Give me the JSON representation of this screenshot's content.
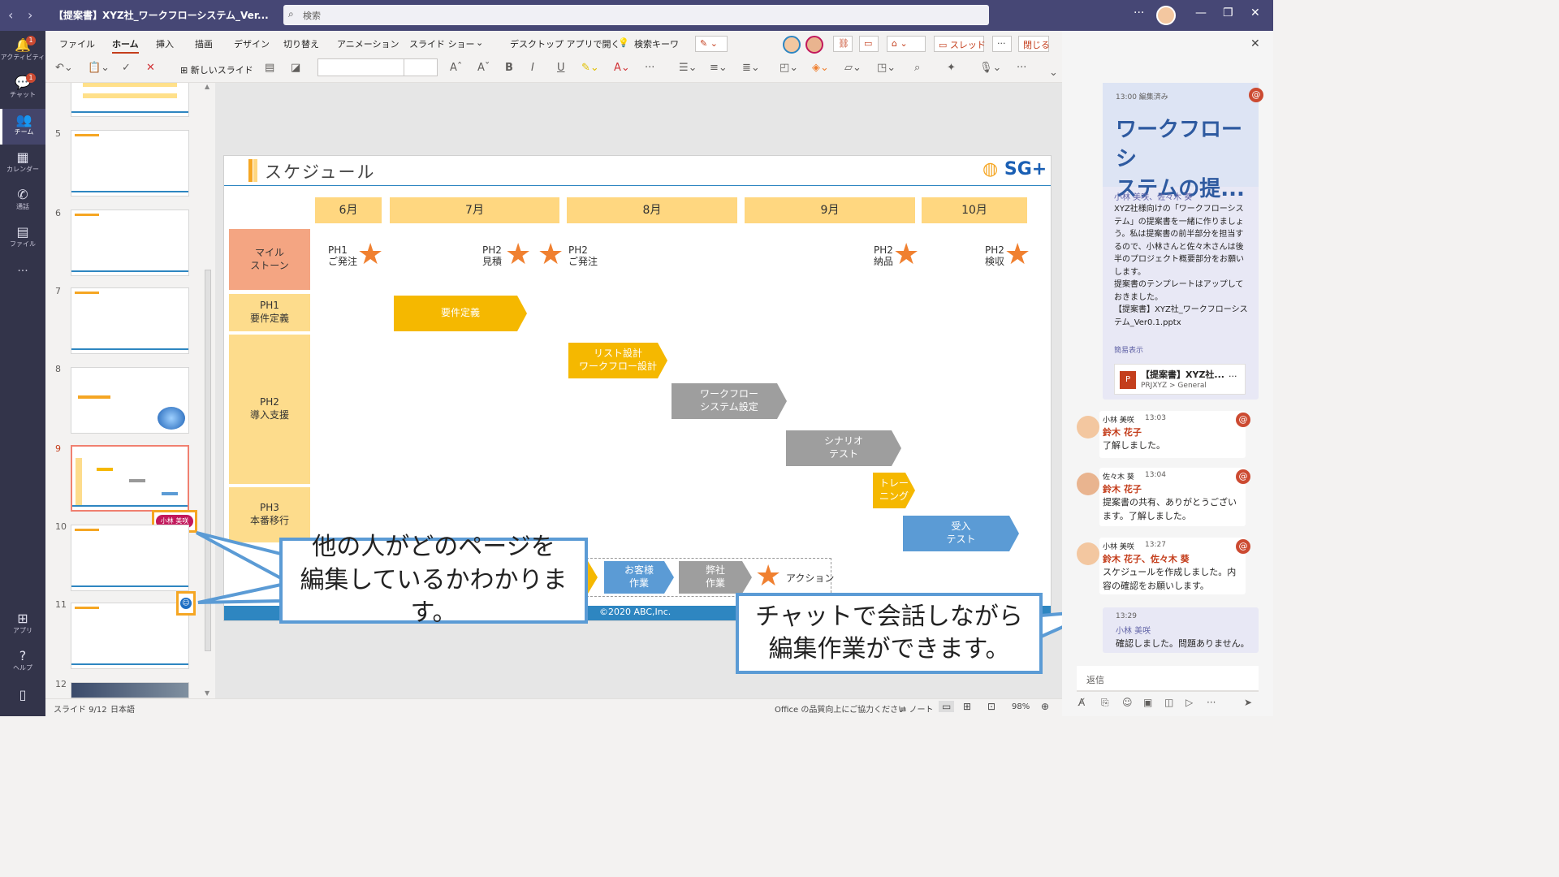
{
  "titlebar": {
    "doc_title": "【提案書】XYZ社_ワークフローシステム_Ver...",
    "search_placeholder": "検索"
  },
  "rail": {
    "items": [
      {
        "label": "アクティビティ",
        "badge": "1"
      },
      {
        "label": "チャット",
        "badge": "1"
      },
      {
        "label": "チーム"
      },
      {
        "label": "カレンダー"
      },
      {
        "label": "通話"
      },
      {
        "label": "ファイル"
      },
      {
        "label": "..."
      },
      {
        "label": "アプリ"
      },
      {
        "label": "ヘルプ"
      }
    ]
  },
  "ribbon": {
    "tabs": [
      "ファイル",
      "ホーム",
      "挿入",
      "描画",
      "デザイン",
      "切り替え",
      "アニメーション",
      "スライド ショー"
    ],
    "open_desktop": "デスクトップ アプリで開く",
    "search_keyword": "検索キーワ",
    "new_slide": "新しいスライド",
    "thread_btn": "スレッド",
    "close_btn": "閉じる"
  },
  "thumbs": {
    "numbers": [
      "5",
      "6",
      "7",
      "8",
      "9",
      "10",
      "11",
      "12"
    ],
    "editor_tag": "小林 美咲"
  },
  "slide": {
    "title": "スケジュール",
    "logo": "SG+",
    "months": [
      "6月",
      "7月",
      "8月",
      "9月",
      "10月"
    ],
    "rows": [
      "マイル\nストーン",
      "PH1\n要件定義",
      "PH2\n導入支援",
      "PH3\n本番移行"
    ],
    "milestones": [
      {
        "text": "PH1\nご発注"
      },
      {
        "text": "PH2\n見積"
      },
      {
        "text": "PH2\nご発注"
      },
      {
        "text": "PH2\n納品"
      },
      {
        "text": "PH2\n検収"
      }
    ],
    "tasks": [
      {
        "label": "要件定義"
      },
      {
        "label": "リスト設計\nワークフロー設計"
      },
      {
        "label": "ワークフロー\nシステム設定"
      },
      {
        "label": "シナリオ\nテスト"
      },
      {
        "label": "トレー\nニング"
      },
      {
        "label": "受入\nテスト"
      }
    ],
    "legend": {
      "customer": "お客様\n作業",
      "ours": "弊社\n作業",
      "action": "アクション"
    },
    "footer": "©2020 ABC,Inc."
  },
  "callouts": {
    "left": "他の人がどのページを\n編集しているかわかります。",
    "right": "チャットで会話しながら\n編集作業ができます。"
  },
  "chat": {
    "post": {
      "time": "13:00 編集済み",
      "title": "ワークフローシ\nステムの提...",
      "mentions": "小林 美咲、佐々木 葵",
      "body": "XYZ社様向けの「ワークフローシステム」の提案書を一緒に作りましょう。私は提案書の前半部分を担当するので、小林さんと佐々木さんは後半のプロジェクト概要部分をお願いします。\n提案書のテンプレートはアップしておきました。\n【提案書】XYZ社_ワークフローシステム_Ver0.1.pptx",
      "collapse": "簡易表示",
      "file_name": "【提案書】XYZ社...",
      "file_path": "PRJXYZ > General"
    },
    "replies": [
      {
        "author": "小林 美咲",
        "time": "13:03",
        "mention": "鈴木 花子",
        "text": "了解しました。"
      },
      {
        "author": "佐々木 葵",
        "time": "13:04",
        "mention": "鈴木 花子",
        "text": "提案書の共有、ありがとうございます。了解しました。"
      },
      {
        "author": "小林 美咲",
        "time": "13:27",
        "mention": "鈴木 花子、佐々木 葵",
        "text": "スケジュールを作成しました。内容の確認をお願いします。"
      },
      {
        "author": "小林 美咲",
        "time": "13:29",
        "text": "確認しました。問題ありません。"
      }
    ],
    "reply_placeholder": "返信"
  },
  "statusbar": {
    "slide": "スライド 9/12",
    "lang": "日本語",
    "feedback": "Office の品質向上にご協力ください",
    "notes": "ノート",
    "zoom": "98%"
  },
  "colors": {
    "teams_purple": "#464775",
    "accent": "#c43e1c",
    "milestone_star": "#f08030",
    "callout_border": "#5b9bd5"
  }
}
